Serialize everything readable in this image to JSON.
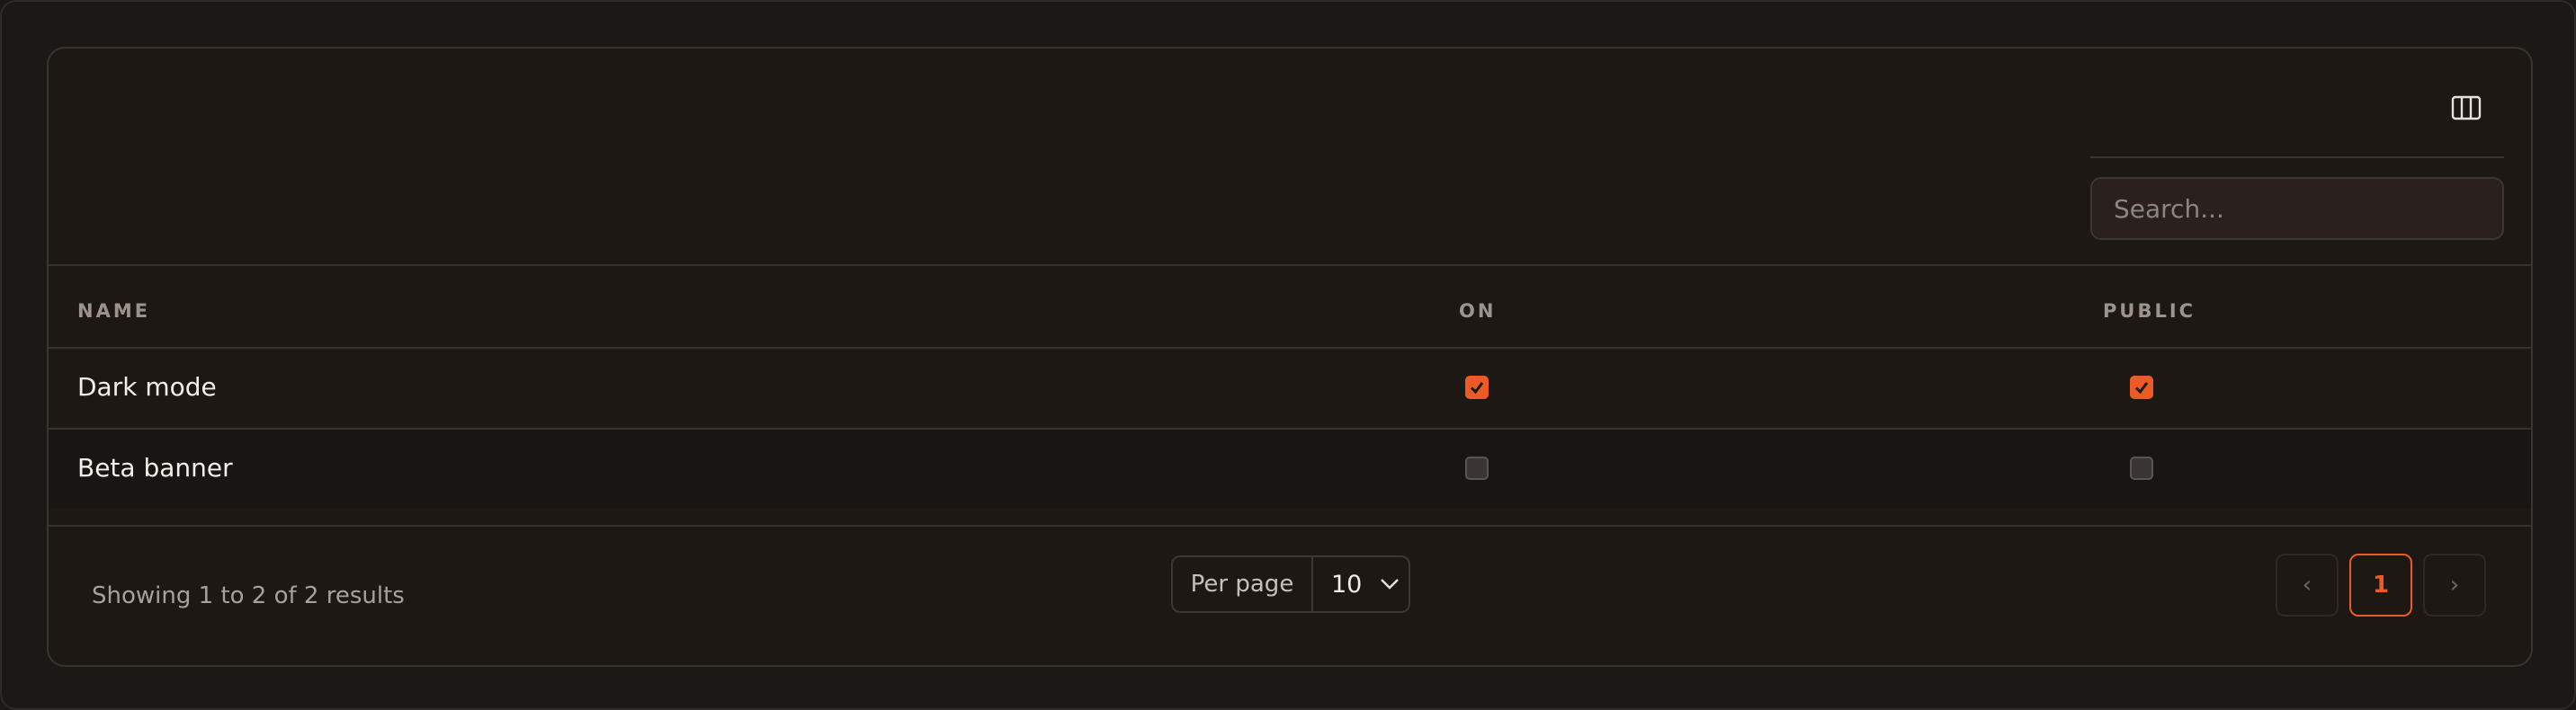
{
  "toolbar": {
    "columns_icon": "columns-icon",
    "search_placeholder": "Search..."
  },
  "table": {
    "columns": [
      "NAME",
      "ON",
      "PUBLIC"
    ],
    "rows": [
      {
        "name": "Dark mode",
        "on": true,
        "public": true
      },
      {
        "name": "Beta banner",
        "on": false,
        "public": false
      }
    ]
  },
  "footer": {
    "showing_text": "Showing 1 to 2 of 2 results",
    "per_page_label": "Per page",
    "per_page_value": "10",
    "prev_label": "‹",
    "current_page": "1",
    "next_label": "›"
  },
  "colors": {
    "accent": "#ec5a26",
    "background": "#1d1814",
    "border": "#3a342f"
  }
}
